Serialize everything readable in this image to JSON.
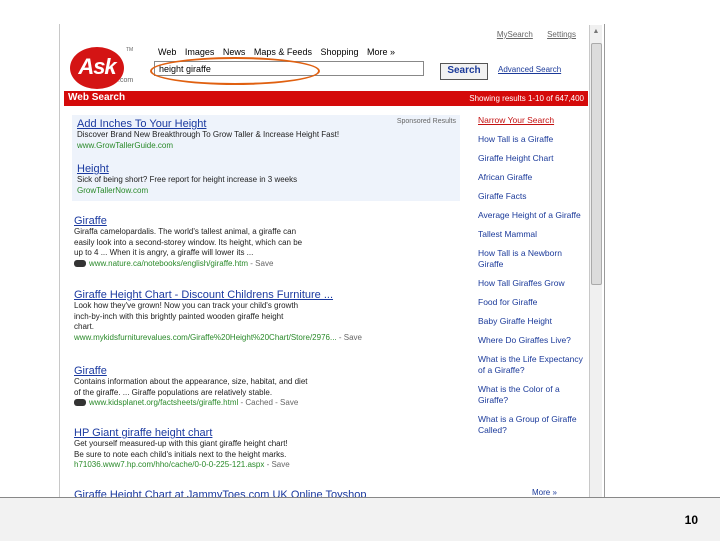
{
  "toplinks": [
    "MySearch",
    "Settings"
  ],
  "logo": {
    "text": "Ask",
    "suffix": ".com",
    "tm": "TM"
  },
  "tabs": [
    "Web",
    "Images",
    "News",
    "Maps & Feeds",
    "Shopping",
    "More »"
  ],
  "search": {
    "query": "height giraffe",
    "button": "Search",
    "advanced": "Advanced Search"
  },
  "results_bar": {
    "title": "Web Search",
    "count": "Showing results 1-10 of 647,400"
  },
  "sponsored": {
    "label": "Sponsored Results",
    "items": [
      {
        "title": "Add Inches To Your Height",
        "desc": "Discover Brand New Breakthrough To Grow Taller & Increase Height Fast!",
        "url": "www.GrowTallerGuide.com"
      },
      {
        "title": "Height",
        "desc": "Sick of being short? Free report for height increase in 3 weeks",
        "url": "GrowTallerNow.com"
      }
    ]
  },
  "results": [
    {
      "title": "Giraffe",
      "desc": [
        "Giraffa camelopardalis. The world's tallest animal, a giraffe can",
        "easily look into a second-storey window. Its height, which can be",
        "up to 4 ... When it is angry, a giraffe will lower its ..."
      ],
      "url": "www.nature.ca/notebooks/english/giraffe.htm",
      "extra": " - Save"
    },
    {
      "title": "Giraffe Height Chart - Discount Childrens Furniture ...",
      "desc": [
        "Look how they've grown! Now you can track your child's growth",
        "inch-by-inch with this brightly painted wooden giraffe height",
        "chart."
      ],
      "url": "www.mykidsfurniturevalues.com/Giraffe%20Height%20Chart/Store/2976...",
      "extra": " - Save"
    },
    {
      "title": "Giraffe",
      "desc": [
        "Contains information about the appearance, size, habitat, and diet",
        "of the giraffe. ... Giraffe populations are relatively stable."
      ],
      "url": "www.kidsplanet.org/factsheets/giraffe.html",
      "extra": " - Cached - Save"
    },
    {
      "title": "HP Giant giraffe height chart",
      "desc": [
        "Get yourself measured-up with this giant giraffe height chart!",
        "Be sure to note each child's initials next to the height marks."
      ],
      "url": "h71036.www7.hp.com/hho/cache/0-0-0-225-121.aspx",
      "extra": " - Save"
    },
    {
      "title": "Giraffe Height Chart at JammyToes.com UK Online Toyshop",
      "desc": [],
      "url": "",
      "extra": ""
    }
  ],
  "sidebar": {
    "items": [
      "Narrow Your Search",
      "How Tall is a Giraffe",
      "Giraffe Height Chart",
      "African Giraffe",
      "Giraffe Facts",
      "Average Height of a Giraffe",
      "Tallest Mammal",
      "How Tall is a Newborn Giraffe",
      "How Tall Giraffes Grow",
      "Food for Giraffe",
      "Baby Giraffe Height",
      "Where Do Giraffes Live?",
      "What is the Life Expectancy of a Giraffe?",
      "What is the Color of a Giraffe?",
      "What is a Group of Giraffe Called?"
    ],
    "more": "More »"
  },
  "slide": {
    "number": "10"
  }
}
